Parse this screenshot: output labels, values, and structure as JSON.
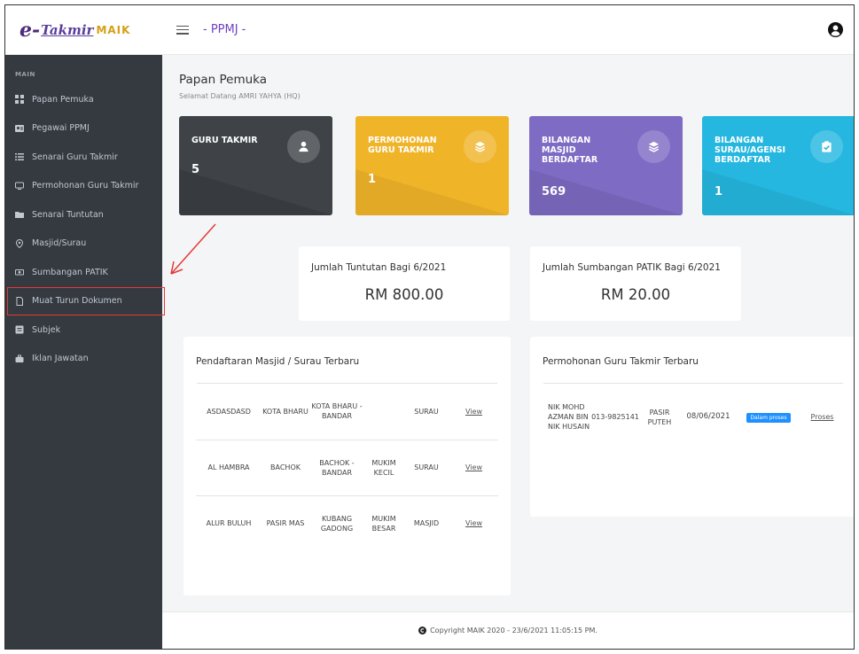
{
  "logo": {
    "e": "e-",
    "takmir": "Takmir",
    "maik": "MAIK"
  },
  "sidebar": {
    "section": "MAIN",
    "items": [
      {
        "label": "Papan Pemuka",
        "icon": "dashboard-icon"
      },
      {
        "label": "Pegawai PPMJ",
        "icon": "user-card-icon"
      },
      {
        "label": "Senarai Guru Takmir",
        "icon": "list-icon"
      },
      {
        "label": "Permohonan Guru Takmir",
        "icon": "monitor-icon"
      },
      {
        "label": "Senarai Tuntutan",
        "icon": "folder-icon"
      },
      {
        "label": "Masjid/Surau",
        "icon": "location-icon"
      },
      {
        "label": "Sumbangan PATIK",
        "icon": "money-icon"
      },
      {
        "label": "Muat Turun Dokumen",
        "icon": "document-icon"
      },
      {
        "label": "Subjek",
        "icon": "book-icon"
      },
      {
        "label": "Iklan Jawatan",
        "icon": "briefcase-icon"
      }
    ]
  },
  "topbar": {
    "title": "- PPMJ -"
  },
  "page": {
    "title": "Papan Pemuka",
    "welcome": "Selamat Datang AMRI YAHYA (HQ)"
  },
  "cards": [
    {
      "label": "GURU TAKMIR",
      "value": "5",
      "color": "#3f4347",
      "icon": "user-icon"
    },
    {
      "label": "PERMOHONAN GURU TAKMIR",
      "value": "1",
      "color": "#f0b429",
      "icon": "layers-icon"
    },
    {
      "label": "BILANGAN MASJID BERDAFTAR",
      "value": "569",
      "color": "#7e6bc4",
      "icon": "layers-icon"
    },
    {
      "label": "BILANGAN SURAU/AGENSI BERDAFTAR",
      "value": "1",
      "color": "#25b7e0",
      "icon": "clipboard-check-icon"
    }
  ],
  "summaries": [
    {
      "title": "Jumlah Tuntutan Bagi 6/2021",
      "value": "RM 800.00"
    },
    {
      "title": "Jumlah Sumbangan PATIK Bagi 6/2021",
      "value": "RM 20.00"
    }
  ],
  "masjid_panel": {
    "title": "Pendaftaran Masjid / Surau Terbaru",
    "rows": [
      [
        "ASDASDASD",
        "KOTA BHARU",
        "KOTA BHARU - BANDAR",
        "",
        "SURAU",
        "View"
      ],
      [
        "AL HAMBRA",
        "BACHOK",
        "BACHOK - BANDAR",
        "MUKIM KECIL",
        "SURAU",
        "View"
      ],
      [
        "ALUR BULUH",
        "PASIR MAS",
        "KUBANG GADONG",
        "MUKIM BESAR",
        "MASJID",
        "View"
      ]
    ]
  },
  "guru_panel": {
    "title": "Permohonan Guru Takmir Terbaru",
    "rows": [
      {
        "name": "NIK MOHD AZMAN BIN NIK HUSAIN",
        "phone": "013-9825141",
        "district": "PASIR PUTEH",
        "date": "08/06/2021",
        "status": "Dalam proses",
        "action": "Proses"
      }
    ]
  },
  "footer": {
    "text": "Copyright MAIK 2020 - 23/6/2021 11:05:15 PM."
  }
}
